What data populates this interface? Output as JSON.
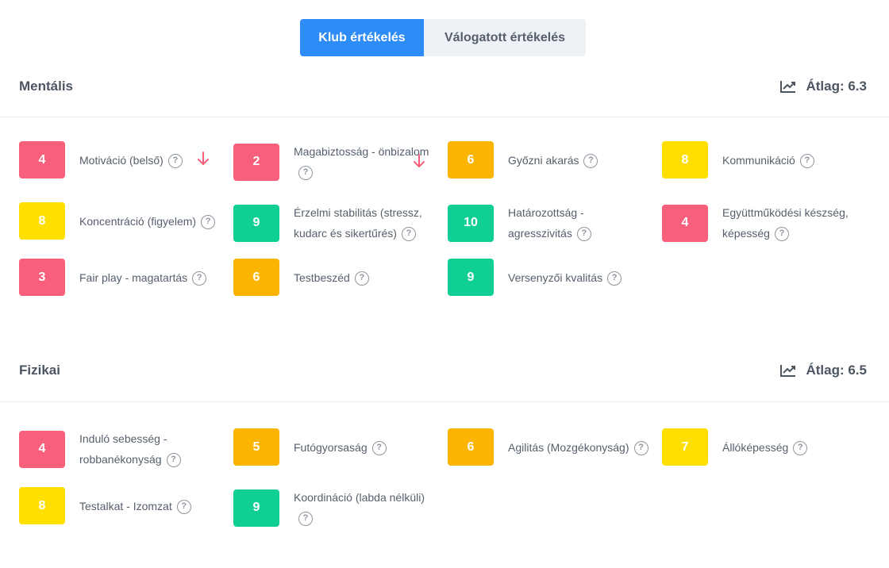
{
  "tabs": {
    "club": "Klub értékelés",
    "national": "Válogatott értékelés"
  },
  "colors": {
    "red": "#f85f7b",
    "orange": "#fbb400",
    "yellow": "#fedf00",
    "green": "#10cf95",
    "accent": "#2d8cf7"
  },
  "sections": [
    {
      "title": "Mentális",
      "average": "Átlag: 6.3",
      "items": [
        {
          "score": "4",
          "color": "red",
          "label": "Motiváció (belső)",
          "trend": "down"
        },
        {
          "score": "2",
          "color": "red",
          "label": "Magabiztosság - önbizalom",
          "trend": "down"
        },
        {
          "score": "6",
          "color": "orange",
          "label": "Győzni akarás"
        },
        {
          "score": "8",
          "color": "yellow",
          "label": "Kommunikáció"
        },
        {
          "score": "8",
          "color": "yellow",
          "label": "Koncentráció (figyelem)"
        },
        {
          "score": "9",
          "color": "green",
          "label": "Érzelmi stabilitás (stressz, kudarc és sikertűrés)"
        },
        {
          "score": "10",
          "color": "green",
          "label": "Határozottság - agresszivitás"
        },
        {
          "score": "4",
          "color": "red",
          "label": "Együttműködési készség, képesség"
        },
        {
          "score": "3",
          "color": "red",
          "label": "Fair play - magatartás"
        },
        {
          "score": "6",
          "color": "orange",
          "label": "Testbeszéd"
        },
        {
          "score": "9",
          "color": "green",
          "label": "Versenyzői kvalitás"
        }
      ]
    },
    {
      "title": "Fizikai",
      "average": "Átlag: 6.5",
      "items": [
        {
          "score": "4",
          "color": "red",
          "label": "Induló sebesség - robbanékonyság"
        },
        {
          "score": "5",
          "color": "orange",
          "label": "Futógyorsaság"
        },
        {
          "score": "6",
          "color": "orange",
          "label": "Agilitás (Mozgékonyság)"
        },
        {
          "score": "7",
          "color": "yellow",
          "label": "Állóképesség"
        },
        {
          "score": "8",
          "color": "yellow",
          "label": "Testalkat - Izomzat"
        },
        {
          "score": "9",
          "color": "green",
          "label": "Koordináció (labda nélküli)"
        }
      ]
    }
  ]
}
